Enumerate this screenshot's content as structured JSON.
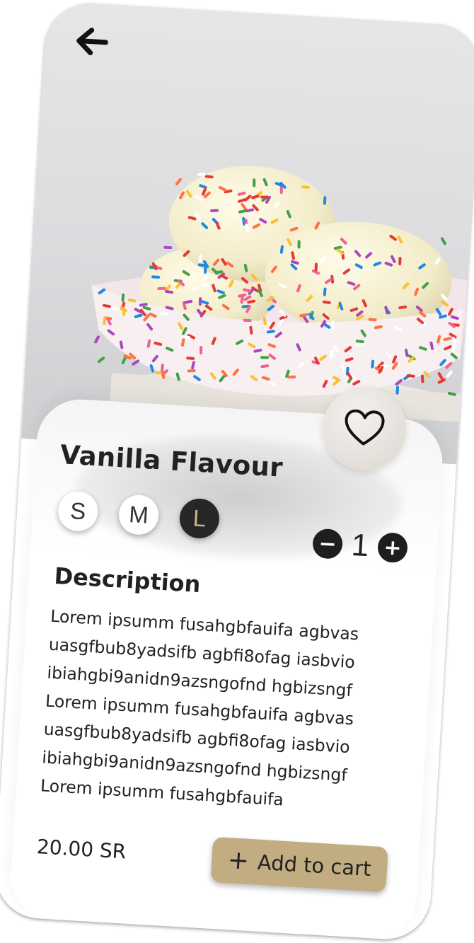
{
  "header": {
    "back_icon": "arrow-left-icon"
  },
  "product": {
    "image_icon": "ice-cream-bowl-image",
    "favorite_icon": "heart-outline-icon",
    "title": "Vanilla Flavour",
    "sizes": [
      {
        "label": "S",
        "selected": false
      },
      {
        "label": "M",
        "selected": false
      },
      {
        "label": "L",
        "selected": true
      }
    ],
    "quantity": {
      "decrement_symbol": "−",
      "value": "1",
      "increment_symbol": "+"
    },
    "description_heading": "Description",
    "description_lines": [
      "Lorem ipsumm fusahgbfauifa agbvas",
      "uasgfbub8yadsifb agbfi8ofag iasbvio",
      "ibiahgbi9anidn9azsngofnd hgbizsngf",
      "Lorem ipsumm fusahgbfauifa agbvas",
      "uasgfbub8yadsifb agbfi8ofag iasbvio",
      "ibiahgbi9anidn9azsngofnd hgbizsngf",
      "Lorem ipsumm fusahgbfauifa"
    ],
    "price": "20.00 SR",
    "add_to_cart": {
      "icon_symbol": "+",
      "label": "Add to cart"
    }
  },
  "colors": {
    "accent": "#c2ad83",
    "selected_size_bg": "#262626",
    "selected_size_text": "#c8b48a",
    "text": "#222222"
  }
}
